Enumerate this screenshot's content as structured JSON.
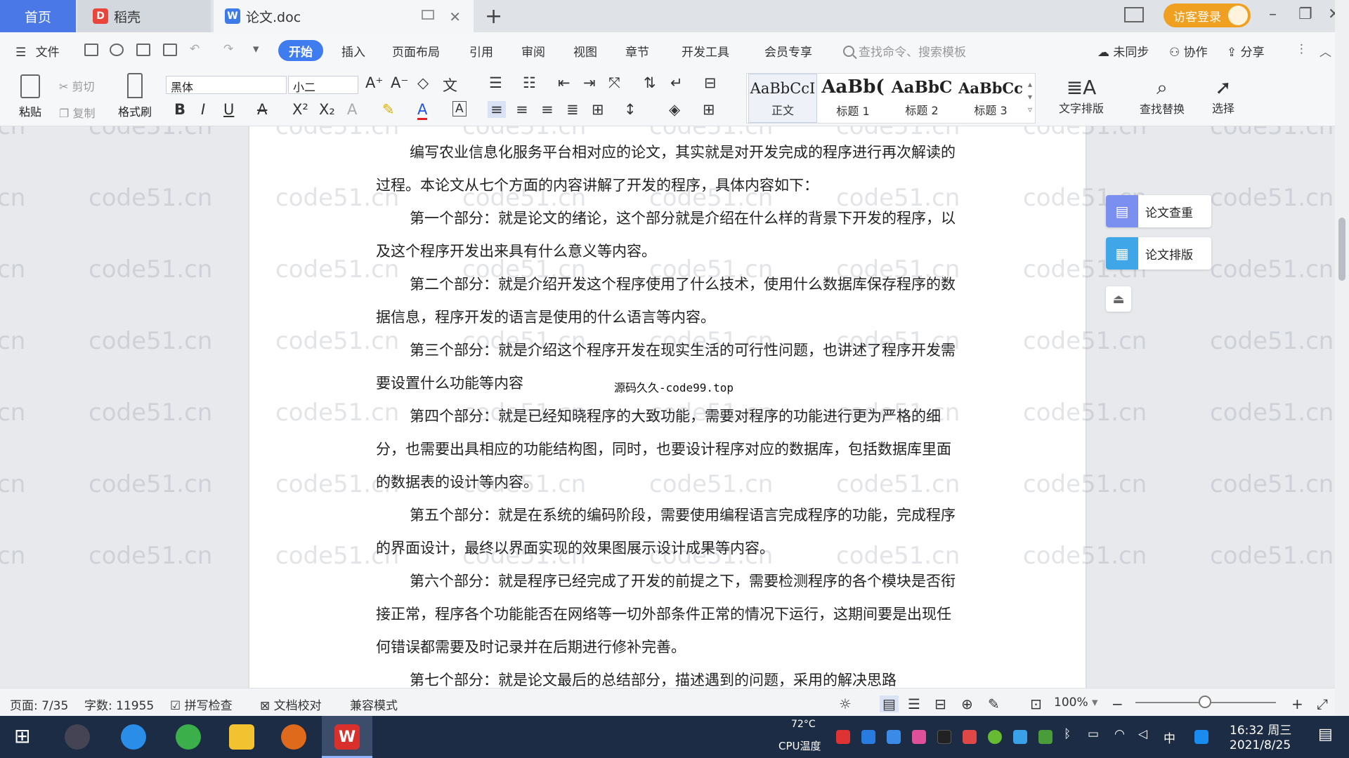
{
  "tabs": {
    "home": "首页",
    "daoke": "稻壳",
    "doc": "论文.doc",
    "visitor_login": "访客登录"
  },
  "menu": {
    "file": "文件",
    "items": [
      "开始",
      "插入",
      "页面布局",
      "引用",
      "审阅",
      "视图",
      "章节",
      "开发工具",
      "会员专享"
    ],
    "search_placeholder": "查找命令、搜索模板",
    "unsynced": "未同步",
    "collaborate": "协作",
    "share": "分享"
  },
  "ribbon": {
    "paste": "粘贴",
    "cut": "剪切",
    "copy": "复制",
    "format_painter": "格式刷",
    "font_name": "黑体",
    "font_size": "小二",
    "styles": [
      {
        "sample": "AaBbCcI",
        "name": "正文"
      },
      {
        "sample": "AaBb(",
        "name": "标题 1"
      },
      {
        "sample": "AaBbC",
        "name": "标题 2"
      },
      {
        "sample": "AaBbCc",
        "name": "标题 3"
      }
    ],
    "text_layout": "文字排版",
    "find_replace": "查找替换",
    "select": "选择"
  },
  "document": {
    "paragraphs": [
      "编写农业信息化服务平台相对应的论文，其实就是对开发完成的程序进行再次解读的过程。本论文从七个方面的内容讲解了开发的程序，具体内容如下：",
      "第一个部分：就是论文的绪论，这个部分就是介绍在什么样的背景下开发的程序，以及这个程序开发出来具有什么意义等内容。",
      "第二个部分：就是介绍开发这个程序使用了什么技术，使用什么数据库保存程序的数据信息，程序开发的语言是使用的什么语言等内容。",
      "第三个部分：就是介绍这个程序开发在现实生活的可行性问题，也讲述了程序开发需要设置什么功能等内容",
      "第四个部分：就是已经知晓程序的大致功能，需要对程序的功能进行更为严格的细分，也需要出具相应的功能结构图，同时，也要设计程序对应的数据库，包括数据库里面的数据表的设计等内容。",
      "第五个部分：就是在系统的编码阶段，需要使用编程语言完成程序的功能，完成程序的界面设计，最终以界面实现的效果图展示设计成果等内容。",
      "第六个部分：就是程序已经完成了开发的前提之下，需要检测程序的各个模块是否衔接正常，程序各个功能能否在网络等一切外部条件正常的情况下运行，这期间要是出现任何错误都需要及时记录并在后期进行修补完善。",
      "第七个部分：就是论文最后的总结部分，描述遇到的问题，采用的解决思路"
    ],
    "overlay": "源码久久-code99.top",
    "watermark": "code51.cn"
  },
  "side_panel": {
    "check": "论文查重",
    "layout": "论文排版"
  },
  "status": {
    "page": "页面: 7/35",
    "words": "字数: 11955",
    "spell_check": "拼写检查",
    "proofread": "文档校对",
    "compat": "兼容模式",
    "zoom": "100%"
  },
  "taskbar": {
    "cpu_temp": "72°C",
    "cpu_label": "CPU温度",
    "ime": "中",
    "time": "16:32 周三",
    "date": "2021/8/25"
  },
  "colors": {
    "accent": "#3f7cf0",
    "home_tab": "#4a78e6",
    "visitor": "#f0a020",
    "taskbar": "#1c2c44"
  }
}
